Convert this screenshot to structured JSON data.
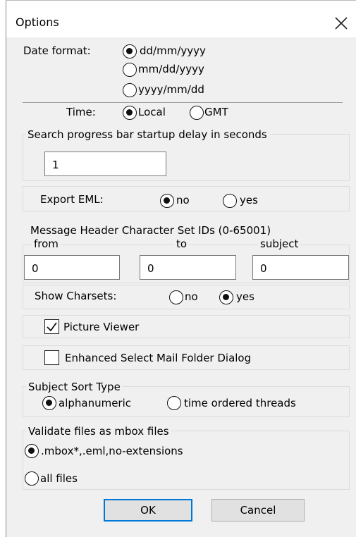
{
  "dialog": {
    "title": "Options",
    "close_icon": "close-icon"
  },
  "date_format": {
    "label": "Date format:",
    "options": [
      "dd/mm/yyyy",
      "mm/dd/yyyy",
      "yyyy/mm/dd"
    ],
    "selected": "dd/mm/yyyy"
  },
  "time": {
    "label": "Time:",
    "options": [
      "Local",
      "GMT"
    ],
    "selected": "Local"
  },
  "search_delay": {
    "label": "Search progress bar startup delay in seconds",
    "value": "1"
  },
  "export_eml": {
    "label": "Export EML:",
    "options": [
      "no",
      "yes"
    ],
    "selected": "no"
  },
  "charset_ids": {
    "label": "Message Header Character Set IDs (0-65001)",
    "from_label": "from",
    "to_label": "to",
    "subject_label": "subject",
    "from_value": "0",
    "to_value": "0",
    "subject_value": "0"
  },
  "show_charsets": {
    "label": "Show Charsets:",
    "options": [
      "no",
      "yes"
    ],
    "selected": "yes"
  },
  "picture_viewer": {
    "label": "Picture Viewer",
    "checked": true
  },
  "enhanced_select": {
    "label": "Enhanced Select Mail Folder Dialog",
    "checked": false
  },
  "subject_sort": {
    "label": "Subject Sort Type",
    "options": [
      "alphanumeric",
      "time ordered threads"
    ],
    "selected": "alphanumeric"
  },
  "validate": {
    "label": "Validate files as mbox files",
    "options": [
      ".mbox*,.eml,no-extensions",
      "all files"
    ],
    "selected": ".mbox*,.eml,no-extensions"
  },
  "buttons": {
    "ok": "OK",
    "cancel": "Cancel"
  },
  "colors": {
    "default_button_border": "#0078d7",
    "dialog_bg": "#f0f0f0"
  }
}
